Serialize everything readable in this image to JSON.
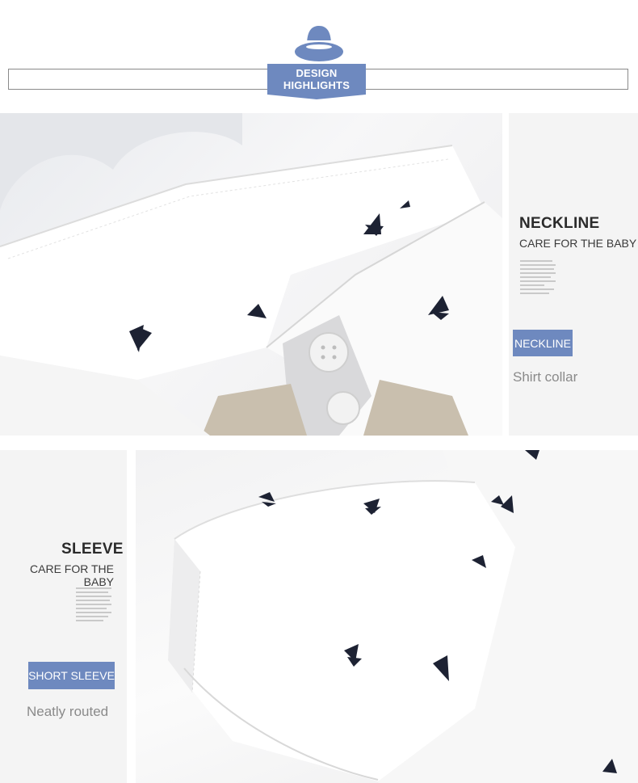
{
  "header": {
    "badge_line1": "DESIGN",
    "badge_line2": "HIGHLIGHTS",
    "icon": "hat-icon",
    "accent_color": "#6e89bf"
  },
  "neckline_section": {
    "title": "NECKLINE",
    "subtitle": "CARE FOR THE BABY",
    "tag": "NECKLINE",
    "caption": "Shirt collar",
    "photo": "shirt-collar-photo"
  },
  "sleeve_section": {
    "title": "SLEEVE",
    "subtitle": "CARE FOR THE BABY",
    "tag": "SHORT SLEEVE",
    "caption": "Neatly routed",
    "photo": "shirt-sleeve-photo"
  }
}
